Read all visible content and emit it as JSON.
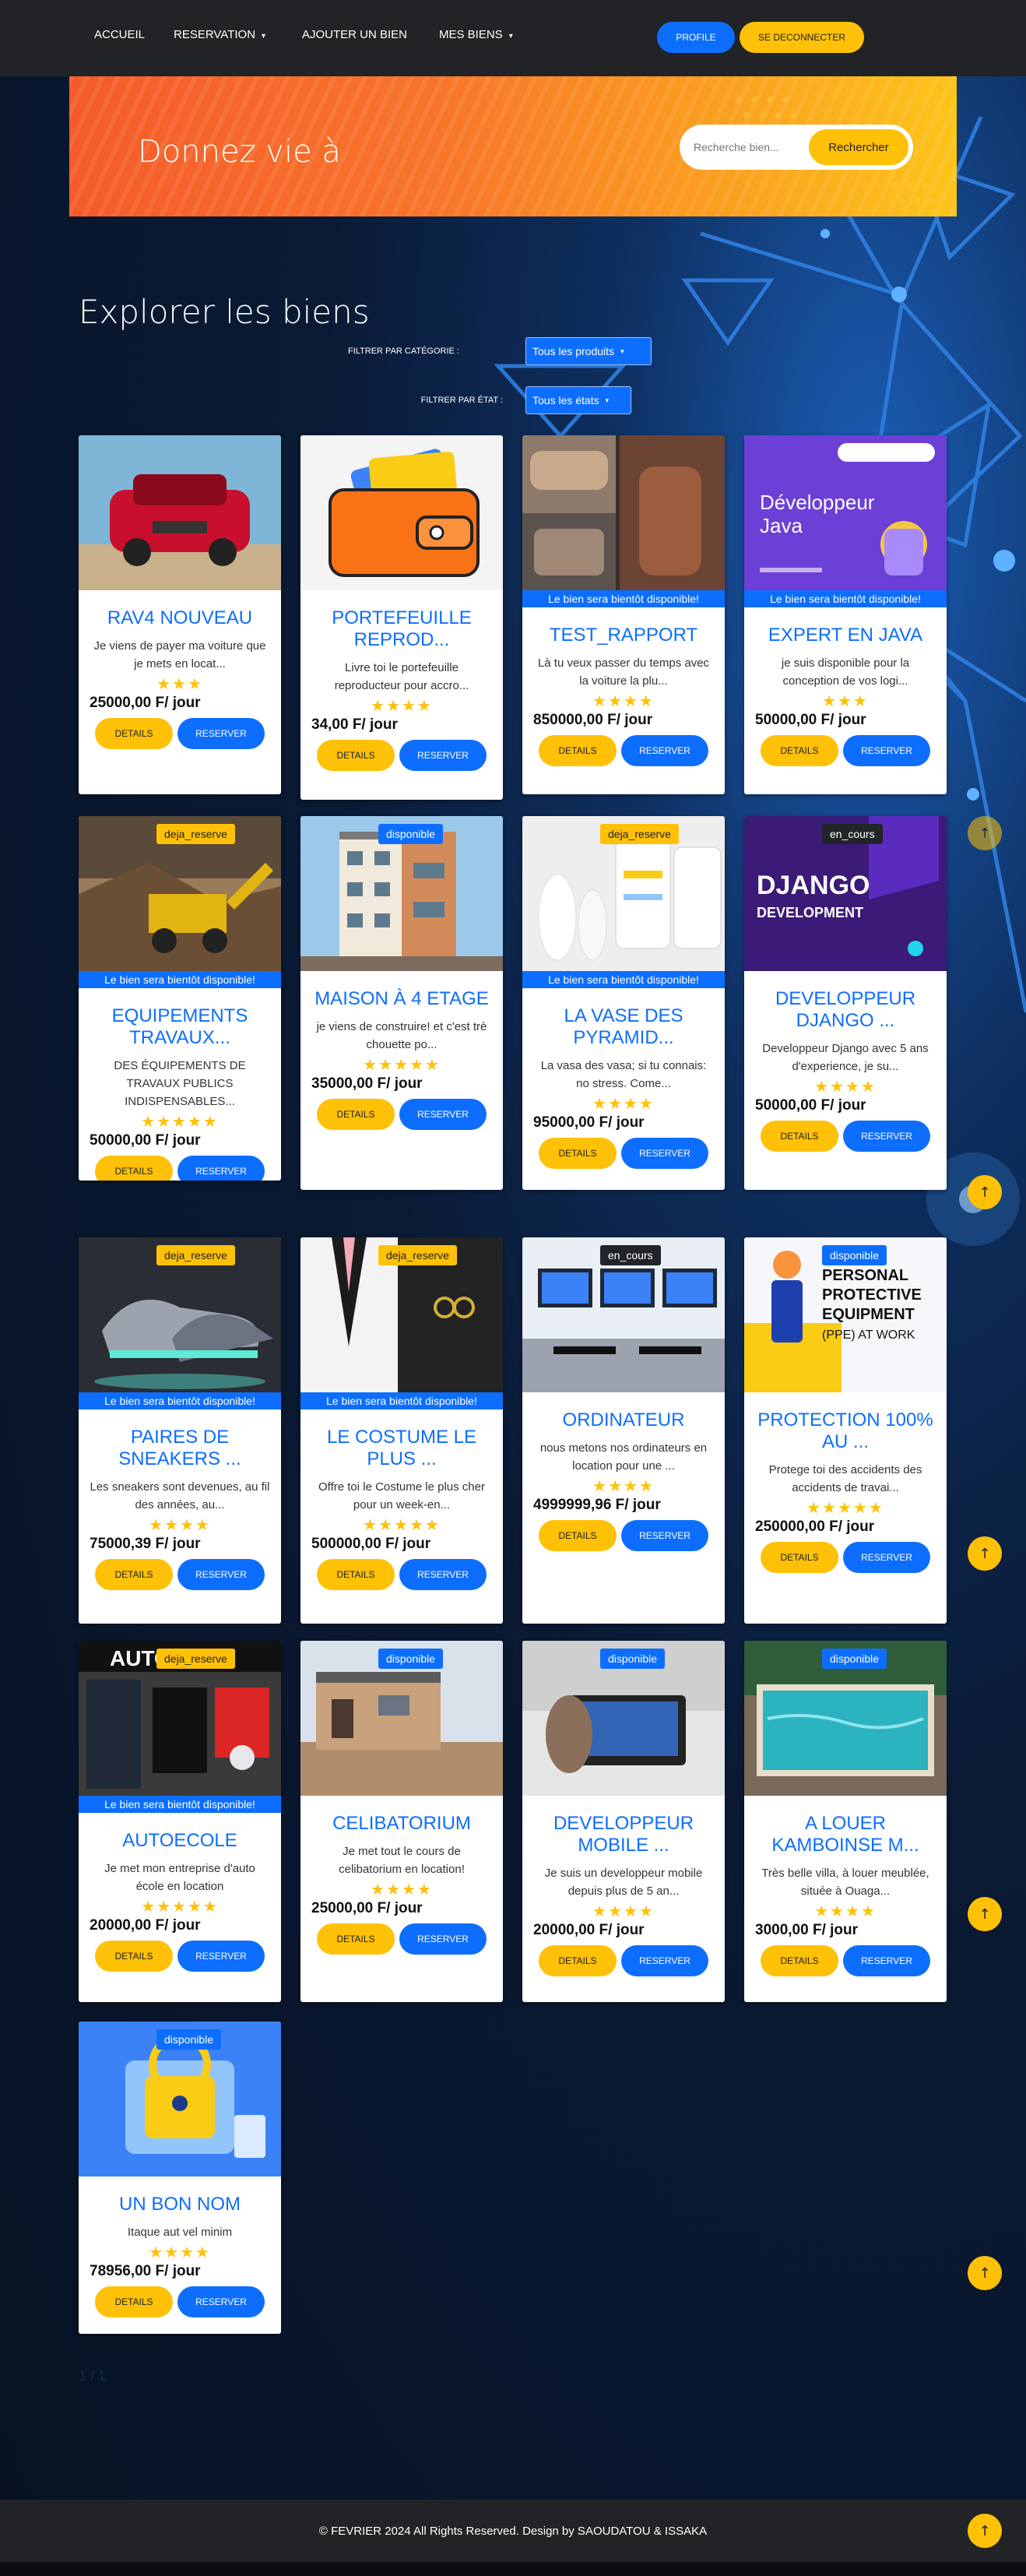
{
  "nav": {
    "links": [
      "ACCUEIL",
      "RESERVATION",
      "AJOUTER UN BIEN",
      "MES BIENS"
    ],
    "profile_label": "PROFILE",
    "logout_label": "SE DECONNECTER"
  },
  "hero": {
    "title": "Donnez vie à",
    "search_placeholder": "Recherche bien...",
    "search_button": "Rechercher"
  },
  "explore": {
    "title": "Explorer les biens",
    "filter_category_label": "FILTRER PAR CATÉGORIE :",
    "filter_category_value": "Tous les produits",
    "filter_state_label": "FILTRER PAR ÉTAT :",
    "filter_state_value": "Tous les états"
  },
  "labels": {
    "details": "DETAILS",
    "reserver": "RESERVER",
    "soon": "Le bien sera bientôt disponible!"
  },
  "colors": {
    "primary": "#0d6efd",
    "warning": "#ffc107",
    "dark": "#222326"
  },
  "cards": [
    {
      "title": "RAV4 NOUVEAU",
      "desc": "Je viens de payer ma voiture que je mets en locat...",
      "stars": "★★★",
      "price": "25000,00 F/ jour",
      "badge": "",
      "soon": false
    },
    {
      "title": "PORTEFEUILLE REPROD...",
      "desc": "Livre toi le portefeuille reproducteur pour accro...",
      "stars": "★★★★",
      "price": "34,00 F/ jour",
      "badge": "",
      "soon": false
    },
    {
      "title": "TEST_RAPPORT",
      "desc": "Là tu veux passer du temps avec la voiture la plu...",
      "stars": "★★★★",
      "price": "850000,00 F/ jour",
      "badge": "",
      "soon": true
    },
    {
      "title": "EXPERT EN JAVA",
      "desc": "je suis disponible pour la conception de vos logi...",
      "stars": "★★★",
      "price": "50000,00 F/ jour",
      "badge": "",
      "soon": true
    },
    {
      "title": "EQUIPEMENTS TRAVAUX...",
      "desc": "DES ÉQUIPEMENTS DE TRAVAUX PUBLICS INDISPENSABLES...",
      "stars": "★★★★★",
      "price": "50000,00 F/ jour",
      "badge": "deja_reserve",
      "soon": true
    },
    {
      "title": "MAISON À 4 ETAGE",
      "desc": "je viens de construire! et c'est trè chouette po...",
      "stars": "★★★★★",
      "price": "35000,00 F/ jour",
      "badge": "disponible",
      "soon": false
    },
    {
      "title": "LA VASE DES PYRAMID...",
      "desc": "La vasa des vasa; si tu connais: no stress. Come...",
      "stars": "★★★★",
      "price": "95000,00 F/ jour",
      "badge": "deja_reserve",
      "soon": true
    },
    {
      "title": "DEVELOPPEUR DJANGO ...",
      "desc": "Developpeur Django avec 5 ans d'experience, je su...",
      "stars": "★★★★",
      "price": "50000,00 F/ jour",
      "badge": "en_cours",
      "soon": false
    },
    {
      "title": "PAIRES DE SNEAKERS ...",
      "desc": "Les sneakers sont devenues, au fil des années, au...",
      "stars": "★★★★",
      "price": "75000,39 F/ jour",
      "badge": "deja_reserve",
      "soon": true
    },
    {
      "title": "LE COSTUME LE PLUS ...",
      "desc": "Offre toi le Costume le plus cher pour un week-en...",
      "stars": "★★★★★",
      "price": "500000,00 F/ jour",
      "badge": "deja_reserve",
      "soon": true
    },
    {
      "title": "ORDINATEUR",
      "desc": "nous metons nos ordinateurs en location pour une ...",
      "stars": "★★★★",
      "price": "4999999,96 F/ jour",
      "badge": "en_cours",
      "soon": false
    },
    {
      "title": "PROTECTION 100% AU ...",
      "desc": "Protege toi des accidents des accidents de travai...",
      "stars": "★★★★★",
      "price": "250000,00 F/ jour",
      "badge": "disponible",
      "soon": false
    },
    {
      "title": "AUTOECOLE",
      "desc": "Je met mon entreprise d'auto école en location",
      "stars": "★★★★★",
      "price": "20000,00 F/ jour",
      "badge": "deja_reserve",
      "soon": true
    },
    {
      "title": "CELIBATORIUM",
      "desc": "Je met tout le cours de celibatorium en location!",
      "stars": "★★★★",
      "price": "25000,00 F/ jour",
      "badge": "disponible",
      "soon": false
    },
    {
      "title": "DEVELOPPEUR MOBILE ...",
      "desc": "Je suis un developpeur mobile depuis plus de 5 an...",
      "stars": "★★★★",
      "price": "20000,00 F/ jour",
      "badge": "disponible",
      "soon": false
    },
    {
      "title": "A LOUER KAMBOINSE M...",
      "desc": "Très belle villa, à louer meublée, située à Ouaga...",
      "stars": "★★★★",
      "price": "3000,00 F/ jour",
      "badge": "disponible",
      "soon": false
    },
    {
      "title": "UN BON NOM",
      "desc": "Itaque aut vel minim",
      "stars": "★★★★",
      "price": "78956,00 F/ jour",
      "badge": "disponible",
      "soon": false
    }
  ],
  "pagination": "1 / 1",
  "footer": "© FEVRIER 2024 All Rights Reserved. Design by SAOUDATOU & ISSAKA"
}
